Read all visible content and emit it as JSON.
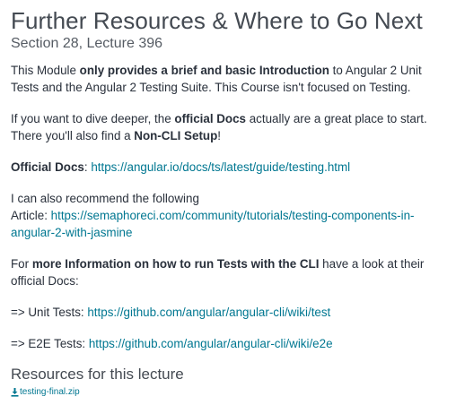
{
  "lecture": {
    "title": "Further Resources & Where to Go Next",
    "subtitle": "Section 28, Lecture 396"
  },
  "content": {
    "p1": {
      "t1": "This Module ",
      "b1": "only provides a brief and basic Introduction",
      "t2": " to Angular 2 Unit Tests and the Angular 2 Testing Suite. This Course isn't focused on Testing."
    },
    "p2": {
      "t1": "If you want to dive deeper, the ",
      "b1": "official Docs",
      "t2": " actually are a great place to start. There you'll also find a ",
      "b2": "Non-CLI Setup",
      "t3": "!"
    },
    "p3": {
      "b1": "Official Docs",
      "t1": ": ",
      "link": "https://angular.io/docs/ts/latest/guide/testing.html"
    },
    "p4": {
      "t1": "I can also recommend the following",
      "t2": "Article: ",
      "link": "https://semaphoreci.com/community/tutorials/testing-components-in-angular-2-with-jasmine"
    },
    "p5": {
      "t1": "For ",
      "b1": "more Information on how to run Tests with the CLI",
      "t2": " have a look at their official Docs:"
    },
    "p6": {
      "t1": "=> Unit Tests: ",
      "link": "https://github.com/angular/angular-cli/wiki/test"
    },
    "p7": {
      "t1": "=> E2E Tests: ",
      "link": "https://github.com/angular/angular-cli/wiki/e2e"
    }
  },
  "resources": {
    "title": "Resources for this lecture",
    "file": "testing-final.zip",
    "icon": "download-icon"
  },
  "colors": {
    "text": "#29303b",
    "link": "#007791",
    "heading": "#444a52"
  }
}
